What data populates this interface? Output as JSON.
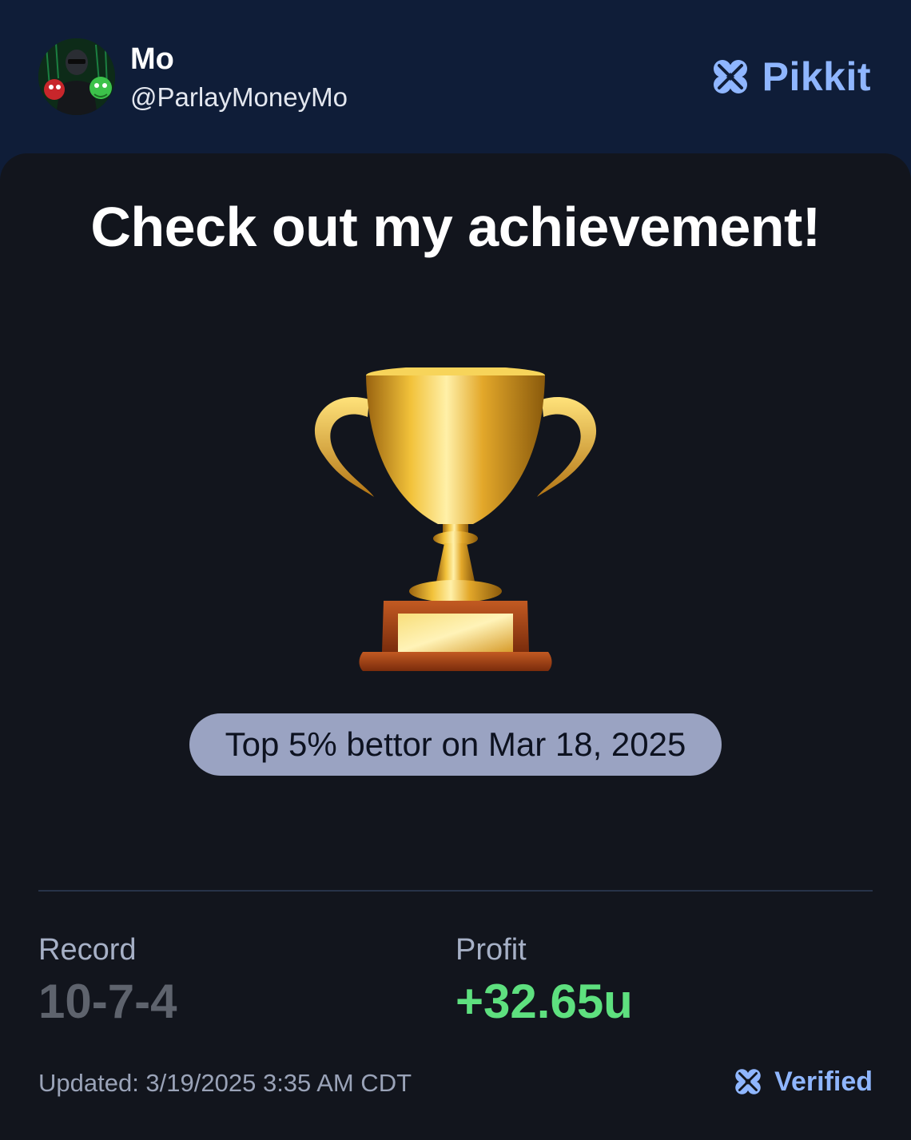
{
  "header": {
    "user": {
      "name": "Mo",
      "handle": "@ParlayMoneyMo"
    },
    "brand": {
      "name": "Pikkit",
      "icon": "clover-icon"
    }
  },
  "card": {
    "title": "Check out my achievement!",
    "image": "trophy-icon",
    "badge": "Top 5% bettor on Mar 18, 2025",
    "stats": {
      "record_label": "Record",
      "record_value": "10-7-4",
      "profit_label": "Profit",
      "profit_value": "+32.65u"
    },
    "footer": {
      "updated": "Updated: 3/19/2025 3:35 AM CDT",
      "verified_label": "Verified",
      "verified_icon": "clover-icon"
    }
  },
  "colors": {
    "header_bg": "#0f1d38",
    "card_bg": "#12151d",
    "accent": "#8fb6ff",
    "profit": "#5ee07f",
    "badge_bg": "#9aa3c2"
  }
}
